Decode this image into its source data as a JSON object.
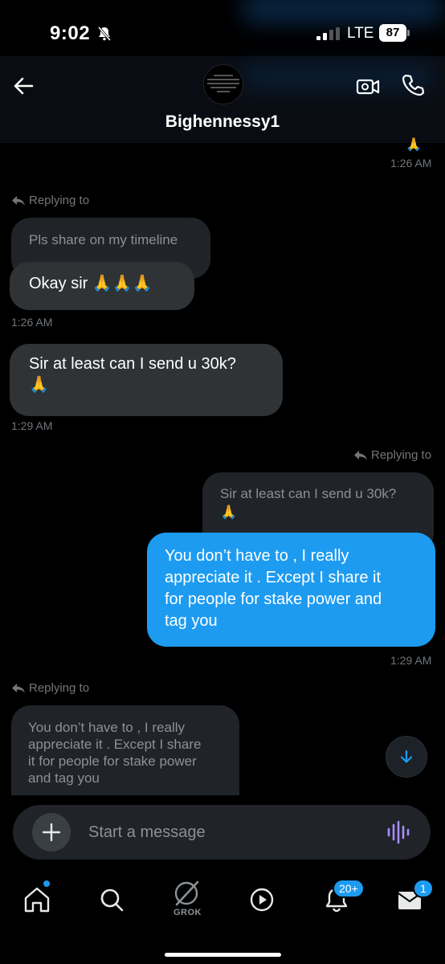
{
  "status_bar": {
    "time": "9:02",
    "network": "LTE",
    "battery": "87"
  },
  "header": {
    "contact_name": "Bighennessy1",
    "back_icon": "arrow-left-icon",
    "video_icon": "video-camera-icon",
    "call_icon": "phone-icon"
  },
  "messages": {
    "ts1": "1:26 AM",
    "reply1_label": "Replying to",
    "reply1_quoted": "Pls share on my timeline",
    "msg1_text": "Okay sir 🙏🙏🙏",
    "ts2": "1:26 AM",
    "msg2_line1": "Sir at least can I send u 30k?",
    "msg2_line2": "🙏",
    "ts3": "1:29 AM",
    "reply2_label": "Replying to",
    "reply2_quoted_line1": "Sir at least can I send u 30k?",
    "reply2_quoted_line2": "🙏",
    "out_line1": "You don’t have to , I really",
    "out_line2": "appreciate it . Except I share it",
    "out_line3": "for people for stake power and",
    "out_line4": "tag you",
    "ts4": "1:29 AM",
    "reply3_label": "Replying to",
    "reply3_line1": "You don’t have to , I really",
    "reply3_line2": "appreciate it . Except I share",
    "reply3_line3": "it for people for stake power",
    "reply3_line4": "and tag you"
  },
  "composer": {
    "placeholder": "Start a message"
  },
  "tabbar": {
    "grok_label": "GROK",
    "notifications_badge": "20+",
    "messages_badge": "1"
  },
  "colors": {
    "accent": "#1d9bf0",
    "bubble_in": "#2f3336",
    "background": "#000000"
  }
}
